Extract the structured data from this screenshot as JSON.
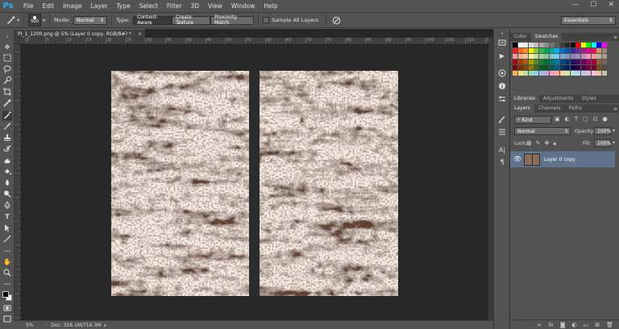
{
  "app": {
    "logo": "Ps",
    "menu": [
      "File",
      "Edit",
      "Image",
      "Layer",
      "Type",
      "Select",
      "Filter",
      "3D",
      "View",
      "Window",
      "Help"
    ],
    "window_controls": [
      "—",
      "☐",
      "✕"
    ]
  },
  "options": {
    "brush_size": "500",
    "mode_label": "Mode:",
    "mode_value": "Normal",
    "type_label": "Type:",
    "type_buttons": [
      "Content-Aware",
      "Create Texture",
      "Proximity Match"
    ],
    "sample_all_layers": "Sample All Layers",
    "workspace": "Essentials"
  },
  "document": {
    "tab_title": "PI_1_1200.png @ 5% (Layer 0 copy, RGB/8#) *",
    "zoom": "5%",
    "doc_info": "Doc: 358.1M/716.3M",
    "ruler_numbers": [
      "0",
      "5",
      "10",
      "15",
      "20",
      "25",
      "30",
      "35",
      "40",
      "45",
      "50",
      "55",
      "60",
      "65",
      "70",
      "75",
      "80",
      "85",
      "90",
      "95",
      "100",
      "105",
      "110",
      "115"
    ]
  },
  "panels": {
    "color_tabs": [
      "Color",
      "Swatches"
    ],
    "library_tabs": [
      "Libraries",
      "Adjustments",
      "Styles"
    ],
    "layer_tabs": [
      "Layers",
      "Channels",
      "Paths"
    ],
    "kind_filter": "Kind",
    "blend_mode": "Normal",
    "opacity_label": "Opacity:",
    "opacity_value": "100%",
    "lock_label": "Lock:",
    "fill_label": "Fill:",
    "fill_value": "100%",
    "layer_name": "Layer 0 copy",
    "footer_icons": [
      "link-icon",
      "fx-icon",
      "mask-icon",
      "adjustment-icon",
      "folder-icon",
      "new-layer-icon",
      "trash-icon"
    ]
  },
  "colors": {
    "accent_logo": "#31a8ff",
    "selected_layer": "#5f748c",
    "canvas_bg": "#282828"
  }
}
